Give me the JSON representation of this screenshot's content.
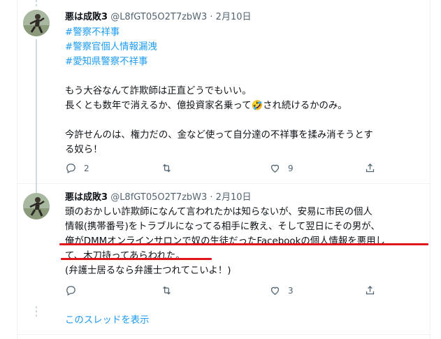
{
  "tweets": [
    {
      "display_name": "悪は成敗3",
      "handle_date": "@L8fGT05O2T7zbW3 · 2月10日",
      "hashtags": [
        "#警察不祥事",
        "#警察官個人情報漏洩",
        "#愛知県警察不祥事"
      ],
      "lines": [
        "もう大谷なんて詐欺師は正直どうでもいい。",
        "長くとも数年で消えるか、億投資家名乗って🤣され続けるかのみ。",
        "",
        "今許せんのは、権力だの、金など使って自分達の不祥事を揉み消そうとす",
        "る奴ら！"
      ],
      "reply_count": "2",
      "retweet_count": "",
      "like_count": "9"
    },
    {
      "display_name": "悪は成敗3",
      "handle_date": "@L8fGT05O2T7zbW3 · 2月10日",
      "lines": [
        "頭のおかしい詐欺師になんて言われたかは知らないが、安易に市民の個人",
        "情報(携帯番号)をトラブルになってる相手に教え、そして翌日にその男が、",
        "俺がDMMオンラインサロンで奴の生徒だったFacebookの個人情報を悪用し",
        "て、木刀持ってあらわれた。",
        "(弁護士居るなら弁護士つれてこいよ！)"
      ],
      "reply_count": "",
      "retweet_count": "",
      "like_count": "3"
    }
  ],
  "show_thread_label": "このスレッドを表示",
  "colors": {
    "link_blue": "#1d9bf0",
    "text_dark": "#0f1419",
    "text_gray": "#536471",
    "annotation_red": "#e0141e"
  },
  "icons": [
    "reply-icon",
    "retweet-icon",
    "like-icon",
    "share-icon"
  ]
}
